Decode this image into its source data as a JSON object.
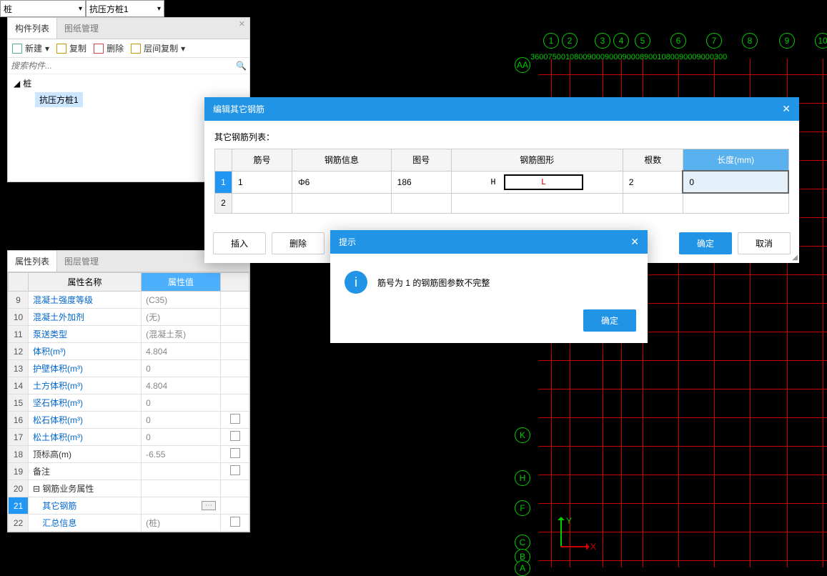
{
  "top": {
    "dd1": "桩",
    "dd2": "抗压方桩1"
  },
  "leftPanel": {
    "tabs": [
      "构件列表",
      "图纸管理"
    ],
    "toolbar": {
      "new": "新建",
      "copy": "复制",
      "delete": "删除",
      "layerCopy": "层间复制"
    },
    "searchPlaceholder": "搜索构件...",
    "tree": {
      "root": "桩",
      "child": "抗压方桩1"
    }
  },
  "propPanel": {
    "tabs": [
      "属性列表",
      "图层管理"
    ],
    "headers": [
      "属性名称",
      "属性值",
      ""
    ],
    "rows": [
      {
        "n": "9",
        "name": "混凝土强度等级",
        "val": "(C35)",
        "blue": true
      },
      {
        "n": "10",
        "name": "混凝土外加剂",
        "val": "(无)",
        "blue": true
      },
      {
        "n": "11",
        "name": "泵送类型",
        "val": "(混凝土泵)",
        "blue": true
      },
      {
        "n": "12",
        "name": "体积(m³)",
        "val": "4.804",
        "blue": true
      },
      {
        "n": "13",
        "name": "护壁体积(m³)",
        "val": "0",
        "blue": true
      },
      {
        "n": "14",
        "name": "土方体积(m³)",
        "val": "4.804",
        "blue": true
      },
      {
        "n": "15",
        "name": "坚石体积(m³)",
        "val": "0",
        "blue": true
      },
      {
        "n": "16",
        "name": "松石体积(m³)",
        "val": "0",
        "blue": true,
        "cb": true
      },
      {
        "n": "17",
        "name": "松土体积(m³)",
        "val": "0",
        "blue": true,
        "cb": true
      },
      {
        "n": "18",
        "name": "顶标高(m)",
        "val": "-6.55",
        "blue": false,
        "cb": true
      },
      {
        "n": "19",
        "name": "备注",
        "val": "",
        "blue": false,
        "cb": true
      },
      {
        "n": "20",
        "name": "钢筋业务属性",
        "val": "",
        "blue": false,
        "group": true
      },
      {
        "n": "21",
        "name": "其它钢筋",
        "val": "",
        "blue": true,
        "sel": true,
        "dots": true
      },
      {
        "n": "22",
        "name": "汇总信息",
        "val": "(桩)",
        "blue": true,
        "cb": true
      }
    ]
  },
  "dlg1": {
    "title": "编辑其它钢筋",
    "listLabel": "其它钢筋列表：",
    "headers": [
      "",
      "筋号",
      "钢筋信息",
      "图号",
      "钢筋图形",
      "根数",
      "长度(mm)"
    ],
    "row": {
      "rn": "1",
      "rebar_no": "1",
      "info": "Φ6",
      "fig_no": "186",
      "shape_h": "H",
      "shape_l": "L",
      "count": "2",
      "length": "0"
    },
    "row2rn": "2",
    "btnInsert": "插入",
    "btnDelete": "删除",
    "btnOk": "确定",
    "btnCancel": "取消"
  },
  "dlg2": {
    "title": "提示",
    "msg": "筋号为 1 的钢筋图参数不完整",
    "ok": "确定"
  },
  "canvas": {
    "topBubbles": [
      "1",
      "2",
      "3",
      "4",
      "5",
      "6",
      "7",
      "8",
      "9",
      "10"
    ],
    "leftBubbles": [
      "AA",
      "K",
      "H",
      "F",
      "C",
      "B",
      "A"
    ],
    "dims": [
      "3600",
      "7500",
      "10800",
      "9000",
      "9000",
      "9000",
      "8900",
      "10800",
      "9000",
      "9000",
      "300"
    ],
    "axis": {
      "y": "Y",
      "x": "X"
    }
  }
}
